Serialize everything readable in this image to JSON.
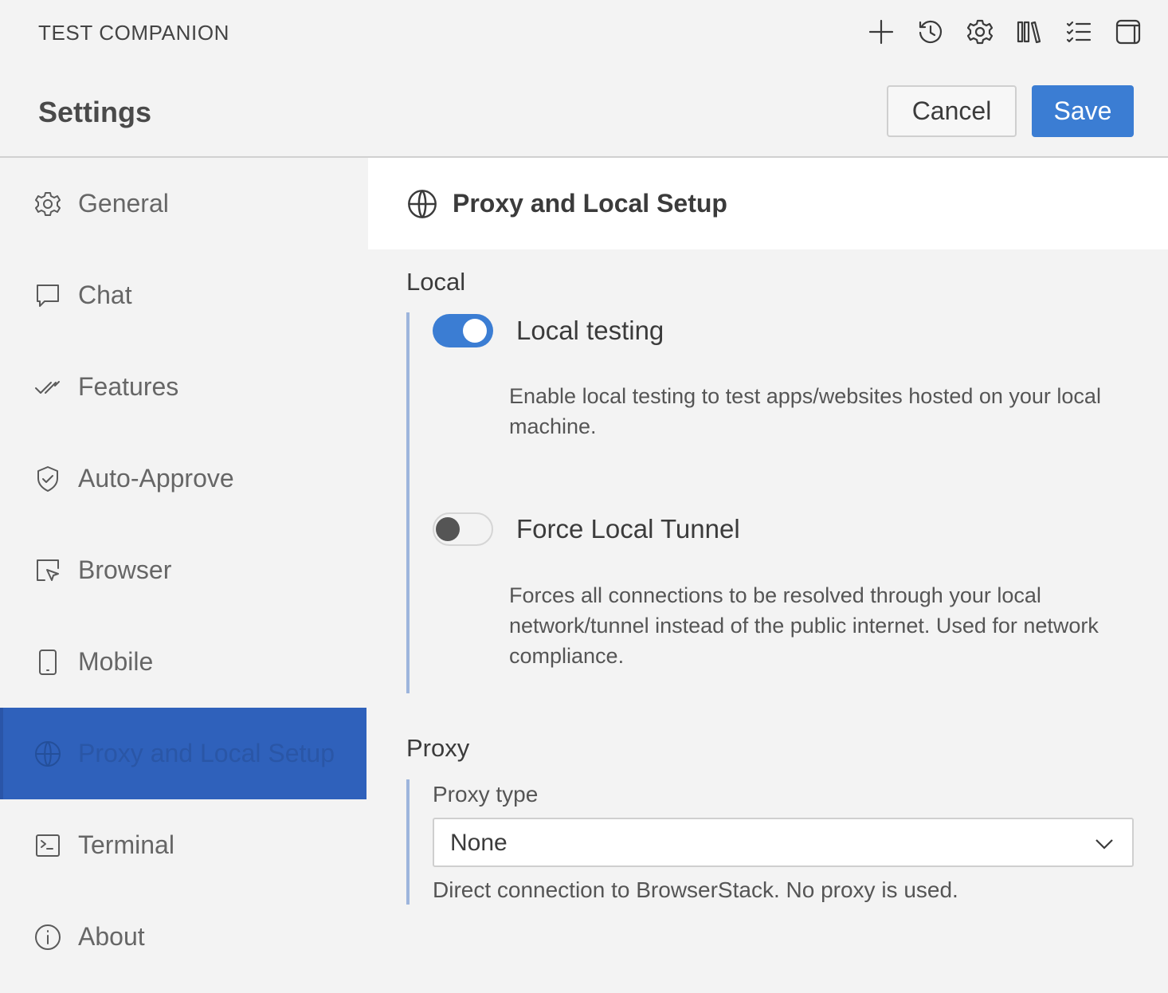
{
  "app": {
    "title": "TEST COMPANION"
  },
  "toolbar": {
    "icons": [
      "plus-icon",
      "history-icon",
      "gear-icon",
      "library-icon",
      "checklist-icon",
      "panel-icon"
    ]
  },
  "header": {
    "title": "Settings",
    "cancel_label": "Cancel",
    "save_label": "Save"
  },
  "sidebar": {
    "items": [
      {
        "label": "General",
        "icon": "gear-icon"
      },
      {
        "label": "Chat",
        "icon": "chat-icon"
      },
      {
        "label": "Features",
        "icon": "double-check-icon"
      },
      {
        "label": "Auto-Approve",
        "icon": "shield-check-icon"
      },
      {
        "label": "Browser",
        "icon": "browser-cursor-icon"
      },
      {
        "label": "Mobile",
        "icon": "mobile-icon"
      },
      {
        "label": "Proxy and Local Setup",
        "icon": "globe-icon",
        "active": true
      },
      {
        "label": "Terminal",
        "icon": "terminal-icon"
      },
      {
        "label": "About",
        "icon": "info-icon"
      }
    ]
  },
  "content": {
    "section_title": "Proxy and Local Setup",
    "local": {
      "title": "Local",
      "local_testing": {
        "label": "Local testing",
        "enabled": true,
        "description": "Enable local testing to test apps/websites hosted on your local machine."
      },
      "force_tunnel": {
        "label": "Force Local Tunnel",
        "enabled": false,
        "description": "Forces all connections to be resolved through your local network/tunnel instead of the public internet. Used for network compliance."
      }
    },
    "proxy": {
      "title": "Proxy",
      "type_label": "Proxy type",
      "type_value": "None",
      "help": "Direct connection to BrowserStack. No proxy is used."
    }
  },
  "colors": {
    "accent": "#3b7dd3",
    "active_nav": "#2f61bb",
    "group_bar": "#9db5dc"
  }
}
